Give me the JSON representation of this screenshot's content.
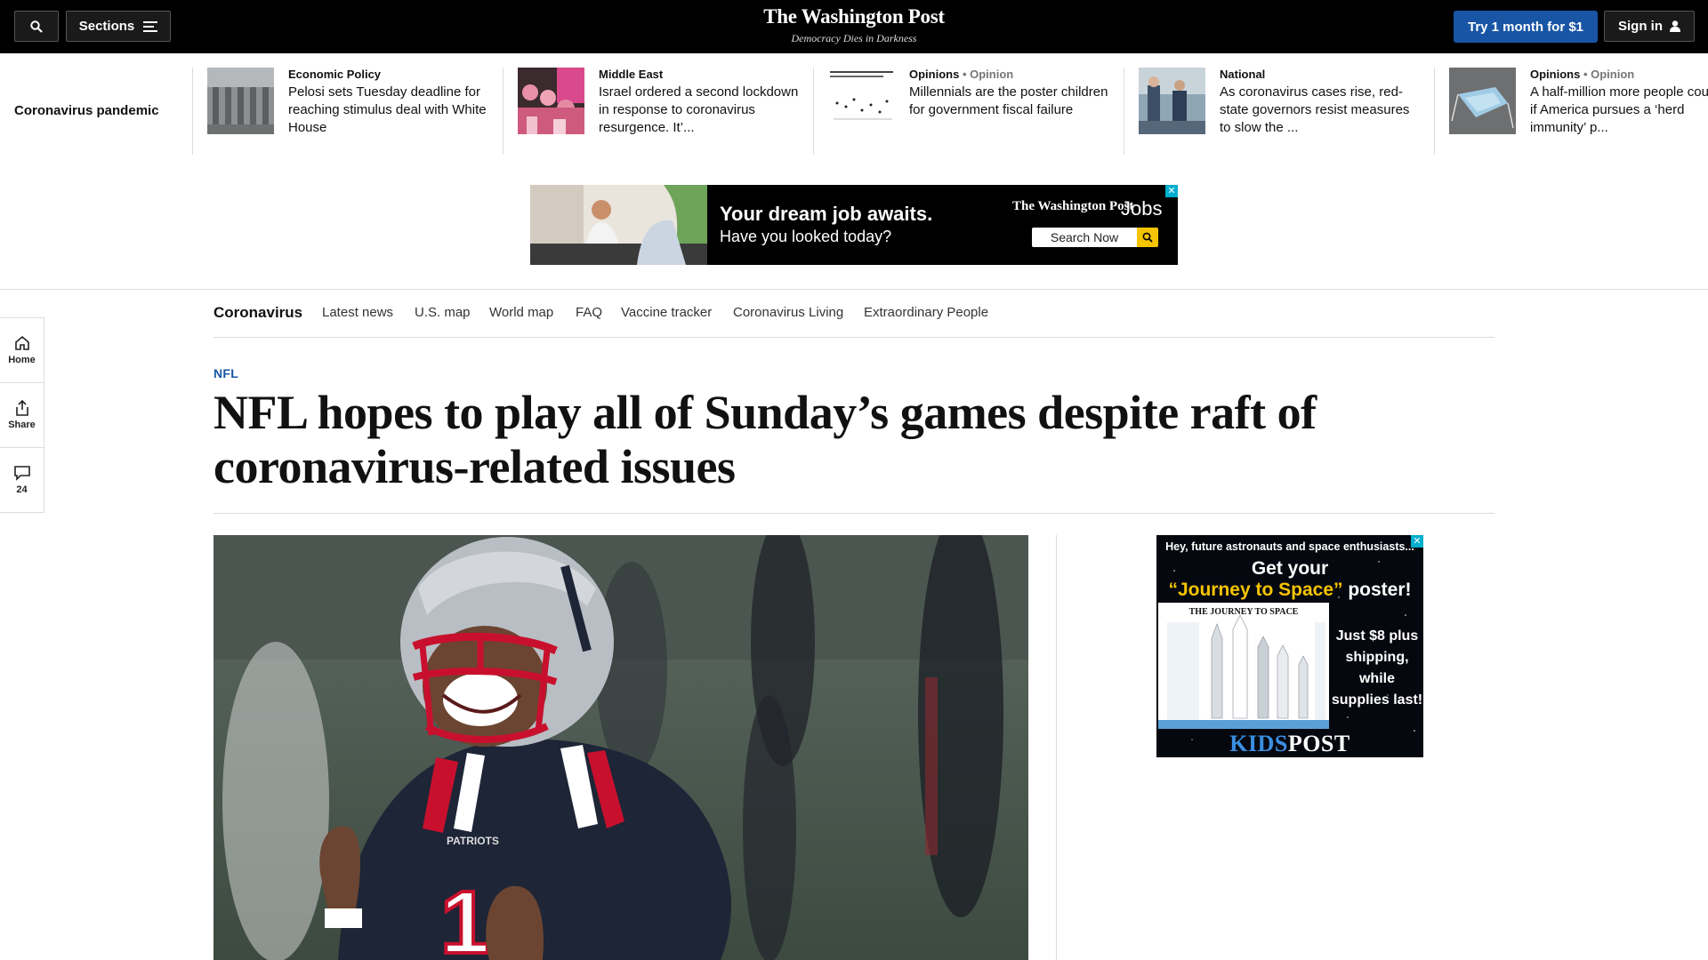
{
  "header": {
    "sections_label": "Sections",
    "logo": "The Washington Post",
    "tagline": "Democracy Dies in Darkness",
    "try_label": "Try 1 month for $1",
    "signin_label": "Sign in",
    "accent": "#1955a5"
  },
  "strip": {
    "title": "Coronavirus pandemic",
    "items": [
      {
        "kicker": "Economic Policy",
        "opinion": "",
        "headline": "Pelosi sets Tuesday deadline for reaching stimulus deal with White House"
      },
      {
        "kicker": "Middle East",
        "opinion": "",
        "headline": "Israel ordered a second lockdown in response to coronavirus resurgence. It’..."
      },
      {
        "kicker": "Opinions",
        "opinion": "• Opinion",
        "headline": "Millennials are the poster children for government fiscal failure"
      },
      {
        "kicker": "National",
        "opinion": "",
        "headline": "As coronavirus cases rise, red-state governors resist measures to slow the ..."
      },
      {
        "kicker": "Opinions",
        "opinion": "• Opinion",
        "headline": "A half-million more people cou die if America pursues a ‘herd immunity’ p..."
      }
    ]
  },
  "ad_jobs": {
    "line1": "Your dream job awaits.",
    "line2": "Have you looked today?",
    "brand": "The Washington Post",
    "jobs_word": "Jobs",
    "search_label": "Search Now"
  },
  "subnav": {
    "items": [
      "Coronavirus",
      "Latest news",
      "U.S. map",
      "World map",
      "FAQ",
      "Vaccine tracker",
      "Coronavirus Living",
      "Extraordinary People"
    ]
  },
  "rail": {
    "home": "Home",
    "share": "Share",
    "comments": "24"
  },
  "article": {
    "kicker": "NFL",
    "headline": "NFL hopes to play all of Sunday’s games despite raft of coronavirus-related issues"
  },
  "ad_kids": {
    "top_line": "Hey, future astronauts and space enthusiasts...",
    "get_your": "Get your",
    "title_quote": "“Journey to Space”",
    "title_rest": " poster!",
    "poster_title": "THE JOURNEY TO SPACE",
    "price_lines": "Just $8 plus shipping, while supplies last!",
    "logo_kids": "KIDS",
    "logo_post": "POST"
  }
}
